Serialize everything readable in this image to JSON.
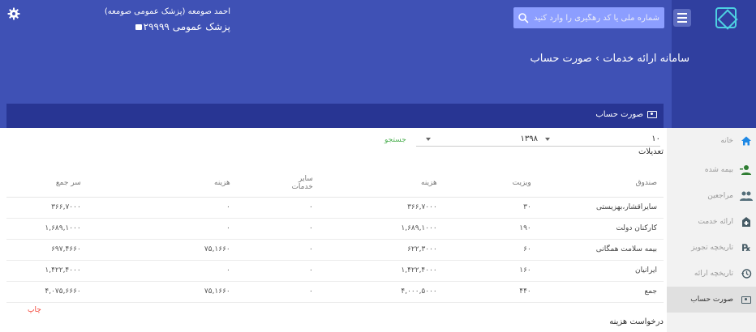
{
  "header": {
    "user_name": "احمد صومعه (پزشک عمومی صومعه)",
    "user_code": "پزشک عمومی ۲۹۹۹۹",
    "page_title": "سامانه ارائه خدمات › صورت حساب"
  },
  "search": {
    "placeholder": "شماره ملی یا کد رهگیری را وارد کنید"
  },
  "card": {
    "title": "صورت حساب"
  },
  "sidebar": {
    "items": [
      {
        "label": "خانه",
        "icon": "home-icon"
      },
      {
        "label": "بیمه شده",
        "icon": "insured-icon"
      },
      {
        "label": "مراجعین",
        "icon": "patients-icon"
      },
      {
        "label": "ارائه خدمت",
        "icon": "service-icon"
      },
      {
        "label": "تاریخچه تجویز",
        "icon": "prescription-icon"
      },
      {
        "label": "تاریخچه ارائه",
        "icon": "history-icon"
      },
      {
        "label": "صورت حساب",
        "icon": "bill-icon",
        "active": true
      }
    ]
  },
  "filters": {
    "count_value": "۱۰",
    "year_value": "۱۳۹۸",
    "search_label": "جستجو"
  },
  "adjustments_label": "تعدیلات",
  "table": {
    "headers": {
      "fund": "صندوق",
      "visit": "ویزیت",
      "cost": "هزینه",
      "other": "سایر خدمات",
      "cost2": "هزینه",
      "total": "سر جمع"
    },
    "rows": [
      {
        "fund": "سایراقشار،بهزیستی",
        "visit": "۳۰",
        "cost": "۳۶۶,۷۰۰۰",
        "other": "۰",
        "cost2": "۰",
        "total": "۳۶۶,۷۰۰۰"
      },
      {
        "fund": "کارکنان دولت",
        "visit": "۱۹۰",
        "cost": "۱,۶۸۹,۱۰۰۰",
        "other": "۰",
        "cost2": "۰",
        "total": "۱,۶۸۹,۱۰۰۰"
      },
      {
        "fund": "بیمه سلامت همگانی",
        "visit": "۶۰",
        "cost": "۶۲۲,۳۰۰۰",
        "other": "۰",
        "cost2": "۷۵,۱۶۶۰",
        "total": "۶۹۷,۴۶۶۰"
      },
      {
        "fund": "ایرانیان",
        "visit": "۱۶۰",
        "cost": "۱,۴۲۲,۴۰۰۰",
        "other": "۰",
        "cost2": "۰",
        "total": "۱,۴۲۲,۴۰۰۰"
      },
      {
        "fund": "جمع",
        "visit": "۴۴۰",
        "cost": "۴,۰۰۰,۵۰۰۰",
        "other": "۰",
        "cost2": "۷۵,۱۶۶۰",
        "total": "۴,۰۷۵,۶۶۶۰"
      }
    ]
  },
  "print_label": "چاپ",
  "request_label": "درخواست هزینه",
  "colors": {
    "primary": "#3f51b5",
    "primary_dark": "#283593",
    "accent_search": "#8c9eff",
    "success": "#4caf50",
    "danger": "#f44336"
  }
}
